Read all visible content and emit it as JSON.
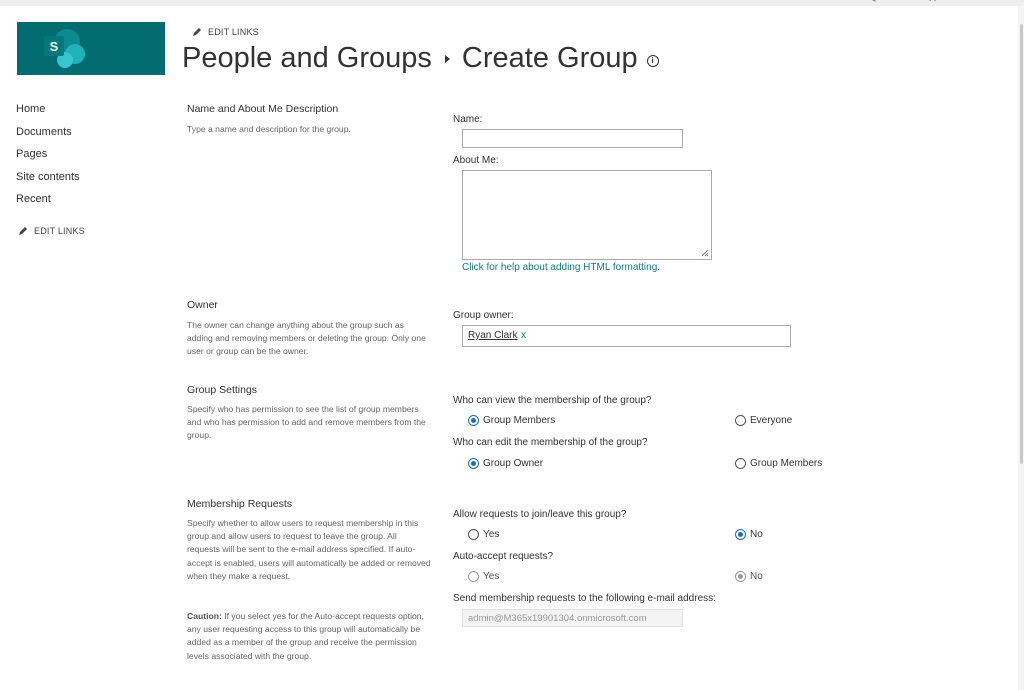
{
  "top": {
    "edit_links": "EDIT LINKS",
    "glyph_1": "◂",
    "glyph_2": "✕"
  },
  "title": {
    "section": "People and Groups",
    "page": "Create Group"
  },
  "logo": {
    "letter": "S",
    "color": "#036c70"
  },
  "nav": {
    "items": [
      "Home",
      "Documents",
      "Pages",
      "Site contents",
      "Recent"
    ],
    "edit_links": "EDIT LINKS"
  },
  "sections": {
    "name_about": {
      "title": "Name and About Me Description",
      "desc": "Type a name and description for the group."
    },
    "owner": {
      "title": "Owner",
      "desc": "The owner can change anything about the group such as adding and removing members or deleting the group. Only one user or group can be the owner."
    },
    "group_settings": {
      "title": "Group Settings",
      "desc": "Specify who has permission to see the list of group members and who has permission to add and remove members from the group."
    },
    "membership": {
      "title": "Membership Requests",
      "desc": "Specify whether to allow users to request membership in this group and allow users to request to leave the group. All requests will be sent to the e-mail address specified. If auto-accept is enabled, users will automatically be added or removed when they make a request.",
      "caution_label": "Caution:",
      "caution_text": " If you select yes for the Auto-accept requests option, any user requesting access to this group will automatically be added as a member of the group and receive the permission levels associated with the group."
    }
  },
  "form": {
    "name_label": "Name:",
    "name_value": "",
    "about_label": "About Me:",
    "about_value": "",
    "help_link": "Click for help about adding HTML formatting.",
    "owner_label": "Group owner:",
    "owner_value": "Ryan Clark",
    "owner_remove": "x",
    "view_question": "Who can view the membership of the group?",
    "view_options": {
      "a": "Group Members",
      "b": "Everyone",
      "selected": "Group Members"
    },
    "edit_question": "Who can edit the membership of the group?",
    "edit_options": {
      "a": "Group Owner",
      "b": "Group Members",
      "selected": "Group Owner"
    },
    "join_question": "Allow requests to join/leave this group?",
    "join_options": {
      "a": "Yes",
      "b": "No",
      "selected": "No"
    },
    "auto_question": "Auto-accept requests?",
    "auto_options": {
      "a": "Yes",
      "b": "No",
      "selected": "No",
      "disabled": true
    },
    "email_question": "Send membership requests to the following e-mail address:",
    "email_value": "admin@M365x19901304.onmicrosoft.com"
  },
  "colors": {
    "accent": "#1a6fc2",
    "link": "#0f7c83",
    "brand": "#036c70"
  }
}
